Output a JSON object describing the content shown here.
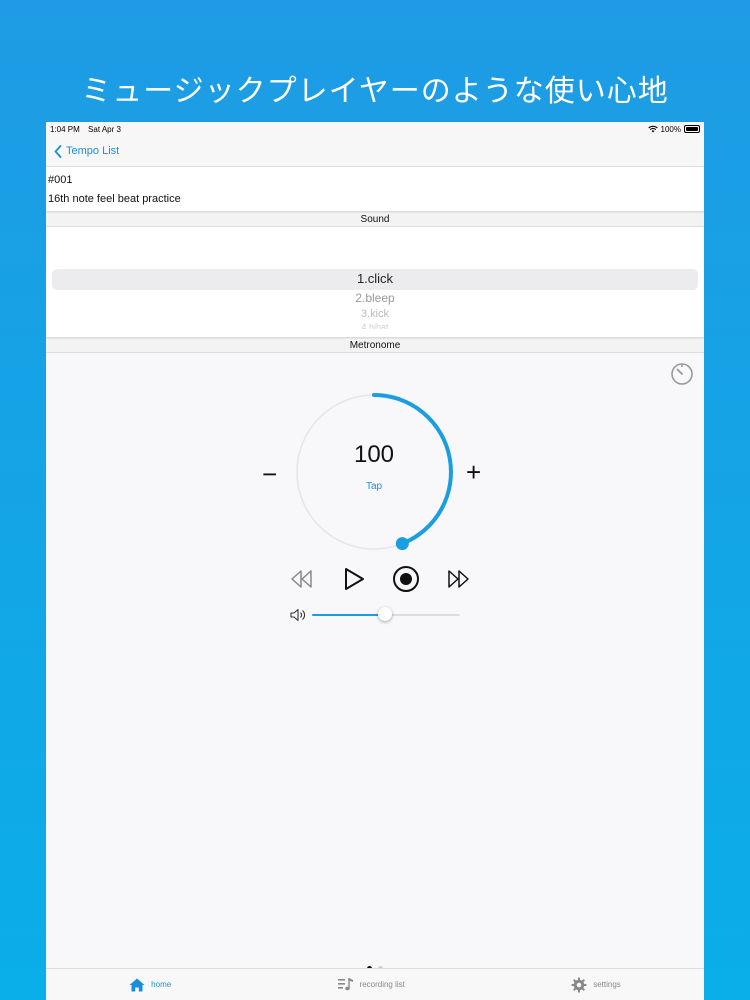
{
  "headline": "ミュージックプレイヤーのような使い心地",
  "status": {
    "time": "1:04 PM",
    "date": "Sat Apr 3",
    "battery": "100%"
  },
  "nav": {
    "back_label": "Tempo List"
  },
  "preset": {
    "number": "#001",
    "title": "16th note feel beat practice"
  },
  "sound": {
    "header": "Sound",
    "options": [
      "1.click",
      "2.bleep",
      "3.kick",
      "4.hihat"
    ],
    "selected": "1.click"
  },
  "metronome": {
    "header": "Metronome",
    "tempo": "100",
    "tap_label": "Tap",
    "minus_label": "−",
    "plus_label": "+",
    "dial_progress": 0.44,
    "volume_level": 0.49
  },
  "pager": {
    "current": 1,
    "total": 2
  },
  "tabs": [
    {
      "label": "home",
      "icon": "home-icon",
      "active": true
    },
    {
      "label": "recording list",
      "icon": "music-list-icon",
      "active": false
    },
    {
      "label": "settings",
      "icon": "gear-icon",
      "active": false
    }
  ],
  "colors": {
    "accent": "#1a9ee0",
    "background_top": "#1e9be4",
    "background_bottom": "#0aaee8"
  }
}
